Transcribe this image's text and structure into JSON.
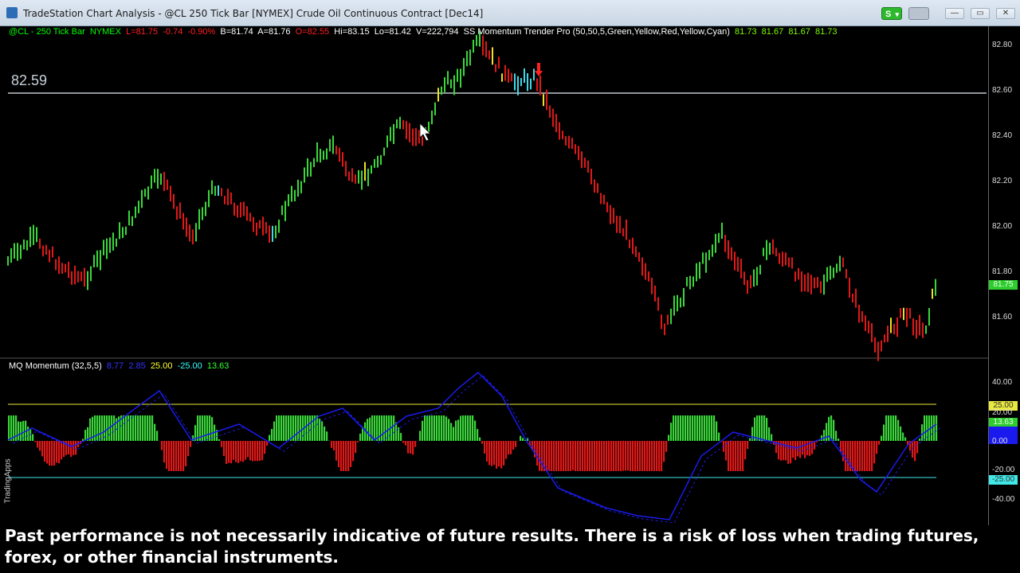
{
  "window": {
    "title": "TradeStation Chart Analysis - @CL 250 Tick Bar [NYMEX] Crude Oil Continuous Contract [Dec14]",
    "s_button": "S",
    "controls": [
      "—",
      "▭",
      "✕"
    ]
  },
  "price_panel": {
    "info": [
      {
        "text": "@CL - 250 Tick Bar  NYMEX",
        "color": "#00ff00"
      },
      {
        "text": "  L=81.75",
        "color": "#ff2020"
      },
      {
        "text": "  -0.74",
        "color": "#ff2020"
      },
      {
        "text": "  -0.90%",
        "color": "#ff2020"
      },
      {
        "text": "  B=81.74",
        "color": "#ffffff"
      },
      {
        "text": "  A=81.76",
        "color": "#ffffff"
      },
      {
        "text": "  O=82.55",
        "color": "#ff2020"
      },
      {
        "text": "  Hi=83.15",
        "color": "#ffffff"
      },
      {
        "text": "  Lo=81.42",
        "color": "#ffffff"
      },
      {
        "text": "  V=222,794",
        "color": "#ffffff"
      },
      {
        "text": "  SS Momentum Trender Pro (50,50,5,Green,Yellow,Red,Yellow,Cyan)",
        "color": "#ffffff"
      },
      {
        "text": "  81.73  81.67  81.67  81.73",
        "color": "#7cfc00"
      }
    ],
    "level_label": "82.59",
    "y_ticks": [
      "82.80",
      "82.60",
      "82.40",
      "82.20",
      "82.00",
      "81.80",
      "81.60"
    ],
    "last_price_tag": "81.75"
  },
  "indicator_panel": {
    "info": [
      {
        "text": "MQ Momentum (32,5,5)",
        "color": "#ffffff"
      },
      {
        "text": "  8.77",
        "color": "#3333ff"
      },
      {
        "text": "  2.85",
        "color": "#3333ff"
      },
      {
        "text": "  25.00",
        "color": "#ffff33"
      },
      {
        "text": "  -25.00",
        "color": "#33ffff"
      },
      {
        "text": "  13.63",
        "color": "#33ff33"
      }
    ],
    "y_ticks": [
      "40.00",
      "20.00",
      "0.00",
      "-20.00",
      "-40.00"
    ],
    "upper_tag": "25.00",
    "lower_tag": "-25.00",
    "hist_tag": "13.63"
  },
  "side_label": "TradingApps",
  "disclaimer": "Past performance is not necessarily indicative of future results. There is a risk of loss when trading futures, forex, or other financial instruments.",
  "colors": {
    "bull": "#3ad63a",
    "bear": "#e01818",
    "neutral": "#3fd8e8",
    "warn": "#f0e020",
    "momentum_line": "#1a1aee",
    "upper_band": "#e8e840",
    "lower_band": "#40e8e8"
  }
}
